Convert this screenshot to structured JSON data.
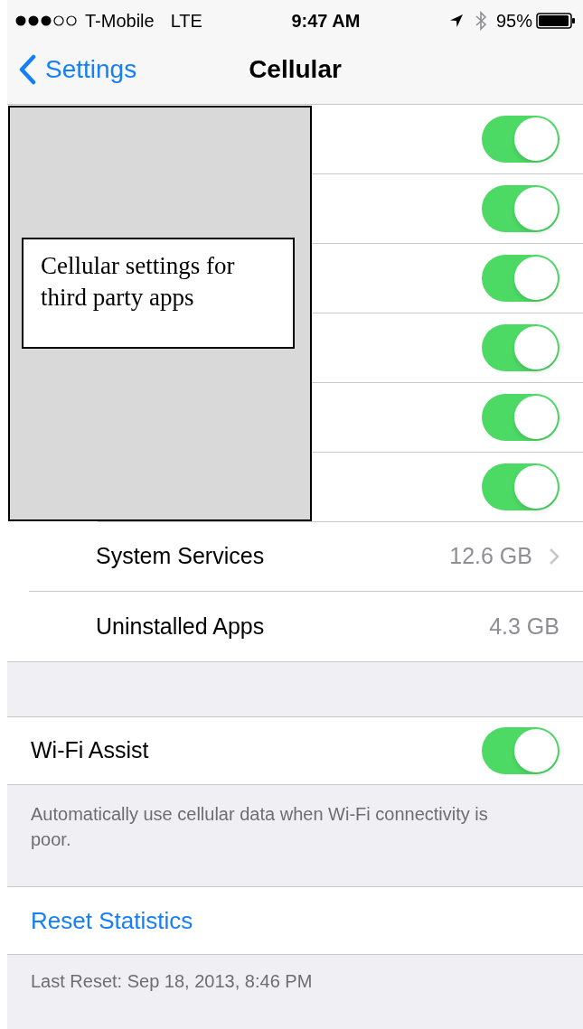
{
  "status_bar": {
    "carrier": "T-Mobile",
    "network": "LTE",
    "time": "9:47 AM",
    "battery": "95%"
  },
  "nav": {
    "back": "Settings",
    "title": "Cellular"
  },
  "app_toggles": [
    {
      "on": true
    },
    {
      "on": true
    },
    {
      "on": true
    },
    {
      "on": true
    },
    {
      "on": true
    },
    {
      "on": true
    }
  ],
  "usage_rows": [
    {
      "label": "System Services",
      "value": "12.6 GB",
      "disclosure": true
    },
    {
      "label": "Uninstalled Apps",
      "value": "4.3 GB",
      "disclosure": false
    }
  ],
  "wifi_assist": {
    "label": "Wi-Fi Assist",
    "on": true,
    "footer": "Automatically use cellular data when Wi-Fi connectivity is poor."
  },
  "reset": {
    "button": "Reset Statistics",
    "footer": "Last Reset: Sep 18, 2013, 8:46 PM"
  },
  "annotation": {
    "text": "Cellular settings for third party apps"
  }
}
